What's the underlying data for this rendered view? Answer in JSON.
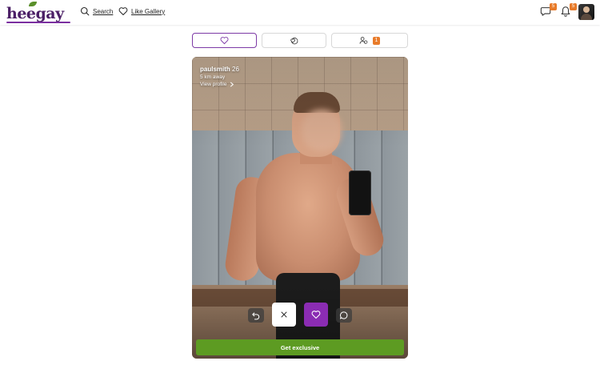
{
  "header": {
    "logo_text": "heegay",
    "nav": {
      "search_label": "Search",
      "gallery_label": "Like Gallery"
    },
    "messages_badge": "5",
    "notifications_badge": "5"
  },
  "tabs": [
    {
      "icon": "heart-icon",
      "active": true
    },
    {
      "icon": "mutual-hearts-icon",
      "active": false
    },
    {
      "icon": "visitors-icon",
      "count": "1",
      "active": false
    }
  ],
  "profile": {
    "username": "paulsmith",
    "age": "26",
    "distance": "5 km away",
    "view_profile": "View profile"
  },
  "actions": {
    "undo_icon": "undo-icon",
    "close_icon": "close-icon",
    "like_icon": "heart-icon",
    "chat_icon": "chat-icon"
  },
  "cta": {
    "exclusive_label": "Get exclusive"
  },
  "colors": {
    "brand_purple": "#8b2cb3",
    "badge_orange": "#e87b2a",
    "cta_green": "#5d9b22"
  }
}
